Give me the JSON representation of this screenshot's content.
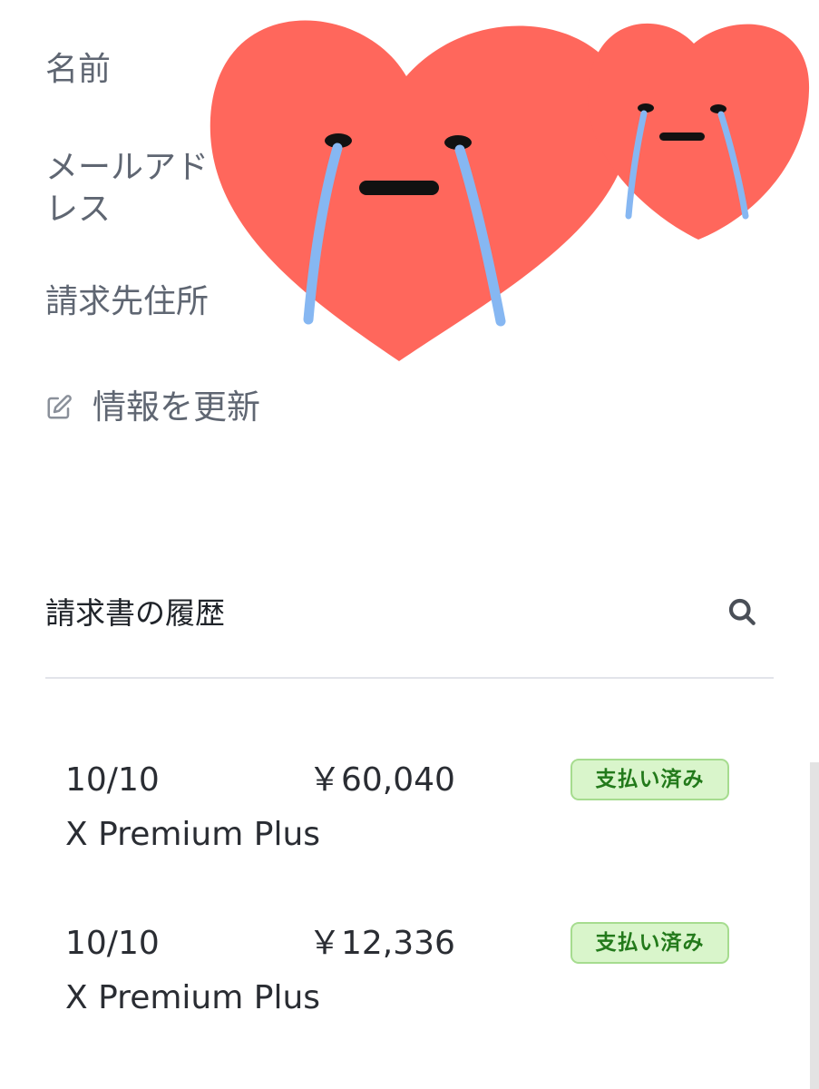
{
  "account_info": {
    "name_label": "名前",
    "email_label": "メールアドレス",
    "billing_address_label": "請求先住所",
    "update_label": "情報を更新",
    "update_icon": "edit-icon"
  },
  "invoice_history": {
    "title": "請求書の履歴",
    "search_icon": "search-icon",
    "invoices": [
      {
        "date": "10/10",
        "amount": "￥60,040",
        "status": "支払い済み",
        "product": "X Premium Plus"
      },
      {
        "date": "10/10",
        "amount": "￥12,336",
        "status": "支払い済み",
        "product": "X Premium Plus"
      }
    ]
  },
  "overlay": {
    "sticker": "crying-heart-sticker"
  },
  "colors": {
    "label_text": "#5f6672",
    "body_text": "#2a2d33",
    "divider": "#e2e4ea",
    "badge_background": "#d9f5cb",
    "badge_border": "#a6dc8f",
    "badge_text": "#237a1b",
    "heart": "#ff675c",
    "tear": "#86b7f2"
  }
}
